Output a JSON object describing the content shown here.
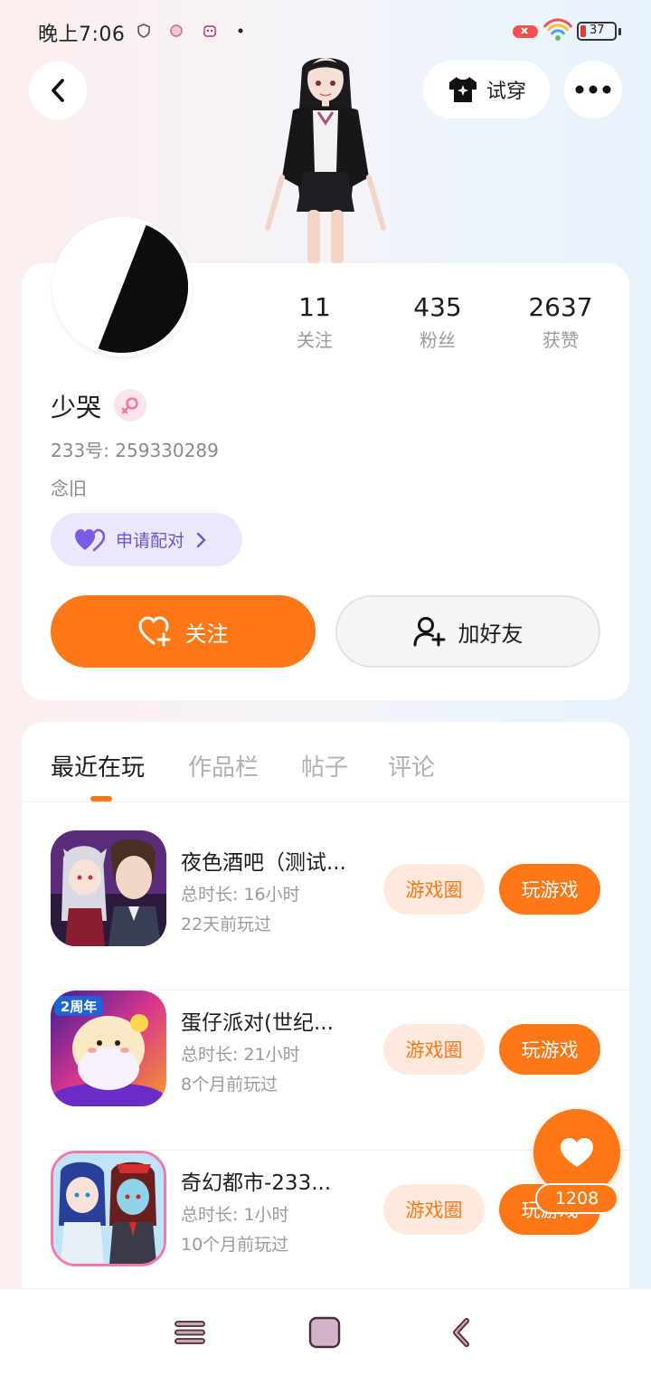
{
  "status_bar": {
    "time": "晚上7:06",
    "battery": "37"
  },
  "header": {
    "tryon_label": "试穿"
  },
  "profile": {
    "stats": [
      {
        "value": "11",
        "label": "关注"
      },
      {
        "value": "435",
        "label": "粉丝"
      },
      {
        "value": "2637",
        "label": "获赞"
      }
    ],
    "nickname": "少哭",
    "uid": "233号: 259330289",
    "signature": "念旧",
    "pair_label": "申请配对",
    "follow_label": "关注",
    "add_friend_label": "加好友"
  },
  "tabs": [
    "最近在玩",
    "作品栏",
    "帖子",
    "评论"
  ],
  "games": [
    {
      "title": "夜色酒吧（测试...",
      "duration": "总时长: 16小时",
      "last_played": "22天前玩过",
      "circle_label": "游戏圈",
      "play_label": "玩游戏"
    },
    {
      "title": "蛋仔派对(世纪...",
      "duration": "总时长: 21小时",
      "last_played": "8个月前玩过",
      "circle_label": "游戏圈",
      "play_label": "玩游戏"
    },
    {
      "title": "奇幻都市-233...",
      "duration": "总时长: 1小时",
      "last_played": "10个月前玩过",
      "circle_label": "游戏圈",
      "play_label": "玩游戏"
    }
  ],
  "game_icon_badges": {
    "party_anniversary": "2周年"
  },
  "like": {
    "count": "1208"
  },
  "colors": {
    "accent": "#fe7818",
    "accent_light": "#fee9dc",
    "pair_purple": "#6b55d4",
    "pair_bg": "#ece8fb",
    "female_pink": "#f07aa0"
  }
}
